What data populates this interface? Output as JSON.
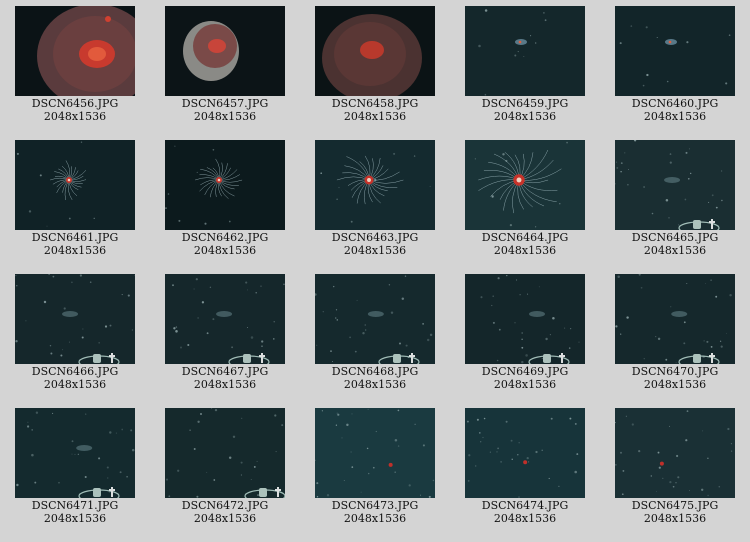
{
  "gallery": {
    "items": [
      {
        "filename": "DSCN6456.JPG",
        "dimensions": "2048x1536",
        "bg": "#0b1316",
        "subject": "jellyfish-bell-large"
      },
      {
        "filename": "DSCN6457.JPG",
        "dimensions": "2048x1536",
        "bg": "#0c1417",
        "subject": "jellyfish-bell-small"
      },
      {
        "filename": "DSCN6458.JPG",
        "dimensions": "2048x1536",
        "bg": "#0b1315",
        "subject": "jellyfish-bell-dark"
      },
      {
        "filename": "DSCN6459.JPG",
        "dimensions": "2048x1536",
        "bg": "#14272b",
        "subject": "tiny-jelly"
      },
      {
        "filename": "DSCN6460.JPG",
        "dimensions": "2048x1536",
        "bg": "#122529",
        "subject": "tiny-jelly"
      },
      {
        "filename": "DSCN6461.JPG",
        "dimensions": "2048x1536",
        "bg": "#102226",
        "subject": "tentacled-jelly-small"
      },
      {
        "filename": "DSCN6462.JPG",
        "dimensions": "2048x1536",
        "bg": "#0c1a1d",
        "subject": "tentacled-jelly-small"
      },
      {
        "filename": "DSCN6463.JPG",
        "dimensions": "2048x1536",
        "bg": "#142a2f",
        "subject": "tentacled-jelly-medium"
      },
      {
        "filename": "DSCN6464.JPG",
        "dimensions": "2048x1536",
        "bg": "#1a3438",
        "subject": "tentacled-jelly-large"
      },
      {
        "filename": "DSCN6465.JPG",
        "dimensions": "2048x1536",
        "bg": "#1a2e32",
        "subject": "particles-with-gear"
      },
      {
        "filename": "DSCN6466.JPG",
        "dimensions": "2048x1536",
        "bg": "#15272b",
        "subject": "particles-with-gear"
      },
      {
        "filename": "DSCN6467.JPG",
        "dimensions": "2048x1536",
        "bg": "#15272b",
        "subject": "particles-with-gear"
      },
      {
        "filename": "DSCN6468.JPG",
        "dimensions": "2048x1536",
        "bg": "#15292d",
        "subject": "particles-with-gear"
      },
      {
        "filename": "DSCN6469.JPG",
        "dimensions": "2048x1536",
        "bg": "#14262a",
        "subject": "particles-with-gear"
      },
      {
        "filename": "DSCN6470.JPG",
        "dimensions": "2048x1536",
        "bg": "#15282c",
        "subject": "particles-with-gear"
      },
      {
        "filename": "DSCN6471.JPG",
        "dimensions": "2048x1536",
        "bg": "#142a2e",
        "subject": "particles-with-gear"
      },
      {
        "filename": "DSCN6472.JPG",
        "dimensions": "2048x1536",
        "bg": "#15292c",
        "subject": "particles-with-gear-small"
      },
      {
        "filename": "DSCN6473.JPG",
        "dimensions": "2048x1536",
        "bg": "#1a3a40",
        "subject": "particles-red-dot"
      },
      {
        "filename": "DSCN6474.JPG",
        "dimensions": "2048x1536",
        "bg": "#17343a",
        "subject": "particles-red-dot"
      },
      {
        "filename": "DSCN6475.JPG",
        "dimensions": "2048x1536",
        "bg": "#1a3035",
        "subject": "particles-red-dot"
      }
    ]
  }
}
